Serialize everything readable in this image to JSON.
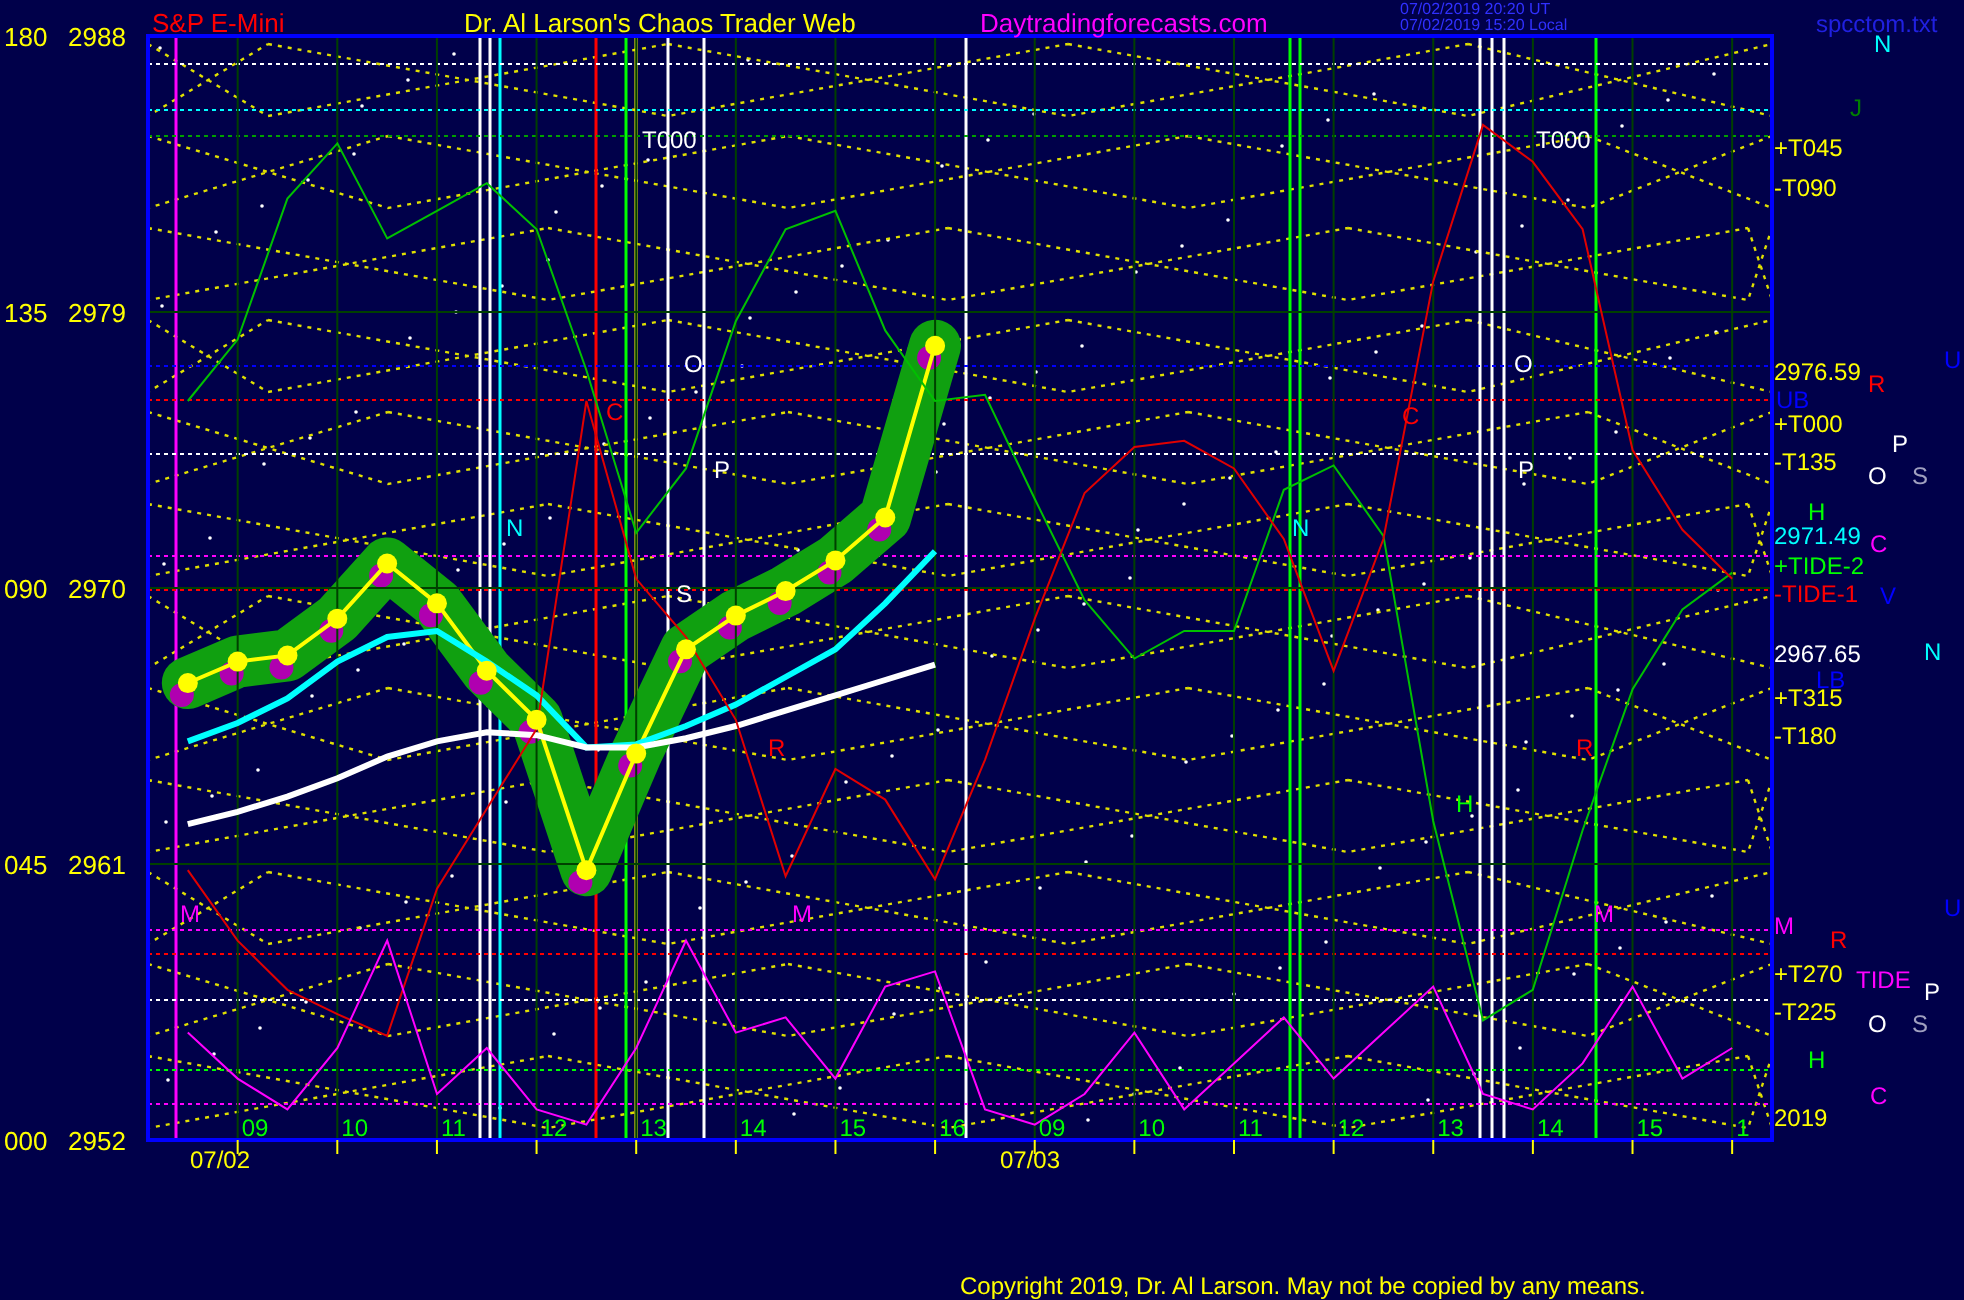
{
  "header": {
    "instrument": "S&P E-Mini",
    "title": "Dr. Al Larson's Chaos Trader Web",
    "website": "Daytradingforecasts.com",
    "timestamps": [
      "07/02/2019 20:20 UT",
      "07/02/2019 15:20 Local"
    ],
    "file": "spcctom.txt"
  },
  "chart": {
    "chart_data": {
      "type": "line",
      "grid": true,
      "ylim": [
        2952,
        2988
      ],
      "categories": [
        null,
        "09",
        null,
        "10",
        null,
        "11",
        null,
        "12",
        null,
        "13",
        null,
        "14",
        null,
        "15",
        null,
        "16",
        null,
        "09",
        null,
        "10",
        null,
        "11",
        null,
        "12",
        null,
        "13",
        null,
        "14",
        null,
        "15",
        null,
        "1"
      ],
      "yticks": [
        {
          "value": 2988,
          "label": "2988"
        },
        {
          "value": 2979,
          "label": "2979"
        },
        {
          "value": 2970,
          "label": "2970"
        },
        {
          "value": 2961,
          "label": "2961"
        },
        {
          "value": 2952,
          "label": "2952"
        }
      ],
      "series": [
        {
          "color": "#ffff00",
          "marker": "circle",
          "values": [
            2966.9,
            2967.6,
            2967.8,
            2969.0,
            2970.8,
            2969.5,
            2967.3,
            2965.7,
            2960.8,
            2964.6,
            2968.0,
            2969.1,
            2969.9,
            2970.9,
            2972.3,
            2977.9,
            null,
            null,
            null,
            null,
            null,
            null,
            null,
            null,
            null,
            null,
            null,
            null,
            null,
            null,
            null,
            null
          ]
        },
        {
          "color": "#00ffff",
          "values": [
            2965.0,
            2965.6,
            2966.4,
            2967.6,
            2968.4,
            2968.6,
            2967.6,
            2966.5,
            2964.8,
            2964.9,
            2965.5,
            2966.2,
            2967.1,
            2968.0,
            2969.5,
            2971.2,
            null,
            null,
            null,
            null,
            null,
            null,
            null,
            null,
            null,
            null,
            null,
            null,
            null,
            null,
            null,
            null
          ]
        },
        {
          "color": "#ffffff",
          "values": [
            2962.3,
            2962.7,
            2963.2,
            2963.8,
            2964.5,
            2965.0,
            2965.3,
            2965.2,
            2964.8,
            2964.8,
            2965.1,
            2965.5,
            2966.0,
            2966.5,
            2967.0,
            2967.5,
            null,
            null,
            null,
            null,
            null,
            null,
            null,
            null,
            null,
            null,
            null,
            null,
            null,
            null,
            null,
            null
          ]
        },
        {
          "color": "#00c000",
          "values": [
            2976.1,
            2978.1,
            2982.7,
            2984.5,
            2981.4,
            2982.3,
            2983.2,
            2981.7,
            2977.1,
            2971.8,
            2973.9,
            2978.7,
            2981.7,
            2982.3,
            2978.4,
            2976.1,
            2976.3,
            2972.9,
            2969.6,
            2967.7,
            2968.6,
            2968.6,
            2973.2,
            2974.0,
            2971.7,
            2962.4,
            2955.9,
            2956.9,
            2962.1,
            2966.7,
            2969.3,
            2970.5
          ]
        },
        {
          "color": "#e00000",
          "values": [
            2960.8,
            2958.5,
            2956.9,
            2956.1,
            2955.4,
            2960.2,
            2962.8,
            2965.4,
            2976.1,
            2970.3,
            2968.4,
            2965.7,
            2960.6,
            2964.1,
            2963.1,
            2960.5,
            2964.4,
            2969.0,
            2973.1,
            2974.6,
            2974.8,
            2973.9,
            2971.6,
            2967.3,
            2971.6,
            2980.0,
            2985.1,
            2983.9,
            2981.7,
            2974.5,
            2971.9,
            2970.3
          ]
        },
        {
          "color": "#ff00ff",
          "values": [
            2955.5,
            2954.0,
            2953.0,
            2955.0,
            2958.5,
            2953.5,
            2955.0,
            2953.0,
            2952.5,
            2955.0,
            2958.5,
            2955.5,
            2956.0,
            2954.0,
            2957.0,
            2957.5,
            2953.0,
            2952.5,
            2953.5,
            2955.5,
            2953.0,
            2954.5,
            2956.0,
            2954.0,
            2955.5,
            2957.0,
            2953.5,
            2953.0,
            2954.5,
            2957.0,
            2954.0,
            2955.0
          ]
        }
      ]
    },
    "angle_labels": [
      "180",
      "135",
      "090",
      "045",
      "000"
    ],
    "date_labels": [
      "07/02",
      "07/03"
    ],
    "right_labels": [
      {
        "text": "+T045",
        "color": "#ffff00"
      },
      {
        "text": "-T090",
        "color": "#ffff00"
      },
      {
        "text": "2976.59",
        "color": "#ffff00"
      },
      {
        "text": "+T000",
        "color": "#ffff00"
      },
      {
        "text": "-T135",
        "color": "#ffff00"
      },
      {
        "text": "2971.49",
        "color": "#00ffff"
      },
      {
        "text": "+TIDE-2",
        "color": "#00ff00"
      },
      {
        "text": "-TIDE-1",
        "color": "#ff0000"
      },
      {
        "text": "2967.65",
        "color": "#ffffff"
      },
      {
        "text": "+T315",
        "color": "#ffff00"
      },
      {
        "text": "-T180",
        "color": "#ffff00"
      },
      {
        "text": "M",
        "color": "#ff00ff"
      },
      {
        "text": "+T270",
        "color": "#ffff00"
      },
      {
        "text": "-T225",
        "color": "#ffff00"
      },
      {
        "text": "2019",
        "color": "#ffff00"
      }
    ],
    "planet_labels": [
      {
        "text": "N",
        "color": "#00ffff"
      },
      {
        "text": "J",
        "color": "#008000"
      },
      {
        "text": "U",
        "color": "#0000ff"
      },
      {
        "text": "R",
        "color": "#ff0000"
      },
      {
        "text": "UB",
        "color": "#0000ff"
      },
      {
        "text": "P",
        "color": "#ffffff"
      },
      {
        "text": "O",
        "color": "#ffffff"
      },
      {
        "text": "S",
        "color": "#a0a0c0"
      },
      {
        "text": "H",
        "color": "#00ff00"
      },
      {
        "text": "C",
        "color": "#ff00ff"
      },
      {
        "text": "V",
        "color": "#0000ff"
      },
      {
        "text": "N",
        "color": "#00ffff"
      },
      {
        "text": "LB",
        "color": "#0000ff"
      },
      {
        "text": "U",
        "color": "#0000ff"
      },
      {
        "text": "R",
        "color": "#ff0000"
      },
      {
        "text": "TIDE",
        "color": "#ff00ff"
      },
      {
        "text": "P",
        "color": "#ffffff"
      },
      {
        "text": "O",
        "color": "#ffffff"
      },
      {
        "text": "S",
        "color": "#a0a0c0"
      },
      {
        "text": "H",
        "color": "#00ff00"
      },
      {
        "text": "C",
        "color": "#ff00ff"
      }
    ],
    "markers": [
      {
        "text": "T000",
        "color": "#ffffff"
      },
      {
        "text": "O",
        "color": "#ffffff"
      },
      {
        "text": "P",
        "color": "#ffffff"
      },
      {
        "text": "N",
        "color": "#00ffff"
      },
      {
        "text": "S",
        "color": "#ffffff"
      },
      {
        "text": "C",
        "color": "#ff0000"
      },
      {
        "text": "R",
        "color": "#ff0000"
      },
      {
        "text": "M",
        "color": "#ff00ff"
      },
      {
        "text": "M",
        "color": "#ff00ff"
      },
      {
        "text": "T000",
        "color": "#ffffff"
      },
      {
        "text": "O",
        "color": "#ffffff"
      },
      {
        "text": "P",
        "color": "#ffffff"
      },
      {
        "text": "N",
        "color": "#00ffff"
      },
      {
        "text": "C",
        "color": "#ff0000"
      },
      {
        "text": "H",
        "color": "#00ff00"
      },
      {
        "text": "R",
        "color": "#ff0000"
      },
      {
        "text": "M",
        "color": "#ff00ff"
      }
    ]
  },
  "footer": "Copyright 2019, Dr. Al Larson. May not be copied by any means."
}
